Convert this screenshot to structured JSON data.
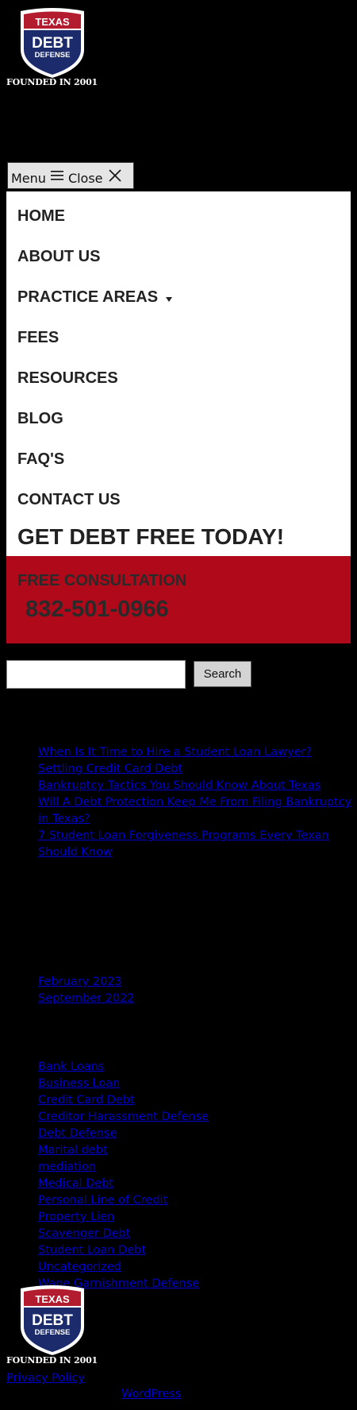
{
  "header": {
    "logo": {
      "top_word": "TEXAS",
      "main_word": "DEBT",
      "sub_word": "DEFENSE"
    },
    "tagline": "FOUNDED IN 2001"
  },
  "menu_toggle": {
    "menu_label": "Menu",
    "close_label": "Close"
  },
  "nav": {
    "items": [
      {
        "label": "HOME"
      },
      {
        "label": "ABOUT US"
      },
      {
        "label": "PRACTICE AREAS",
        "has_submenu": true
      },
      {
        "label": "FEES"
      },
      {
        "label": "RESOURCES"
      },
      {
        "label": "BLOG"
      },
      {
        "label": "FAQ'S"
      },
      {
        "label": "CONTACT US"
      }
    ],
    "cta_heading": "GET DEBT FREE TODAY!"
  },
  "consultation": {
    "label": "FREE CONSULTATION",
    "phone": "832-501-0966"
  },
  "search": {
    "value": "",
    "button_label": "Search"
  },
  "recent_posts": [
    "When Is It Time to Hire a Student Loan Lawyer?",
    "Settling Credit Card Debt",
    "Bankruptcy Tactics You Should Know About Texas",
    "Will A Debt Protection Keep Me From Filing Bankruptcy in Texas?",
    "7 Student Loan Forgiveness Programs Every Texan Should Know"
  ],
  "archives": [
    "February 2023",
    "September 2022"
  ],
  "categories": [
    "Bank Loans",
    "Business Loan",
    "Credit Card Debt",
    "Creditor Harassment Defense",
    "Debt Defense",
    "Marital debt",
    "mediation",
    "Medical Debt",
    "Personal Line of Credit",
    "Property Lien",
    "Scavenger Debt",
    "Student Loan Debt",
    "Uncategorized",
    "Wage Garnishment Defense"
  ],
  "footer": {
    "logo": {
      "top_word": "TEXAS",
      "main_word": "DEBT",
      "sub_word": "DEFENSE"
    },
    "tagline": "FOUNDED IN 2001",
    "privacy_label": "Privacy Policy",
    "wordpress_label": "WordPress"
  },
  "colors": {
    "page_background": "#000000",
    "logo_red": "#b31b2e",
    "logo_navy": "#1b2b6b",
    "consult_band": "#b00a1a",
    "link": "#0000cc"
  }
}
